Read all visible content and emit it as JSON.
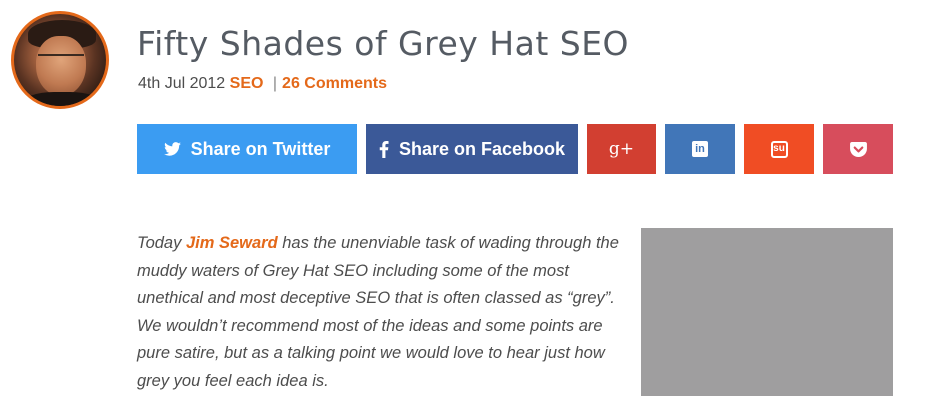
{
  "post": {
    "title": "Fifty Shades of Grey Hat SEO",
    "date": "4th Jul 2012",
    "category": "SEO",
    "separator": "|",
    "comments": "26 Comments"
  },
  "share": {
    "twitter": {
      "label": "Share on Twitter",
      "color": "#3b9cf2",
      "icon": "twitter-bird-icon"
    },
    "facebook": {
      "label": "Share on Facebook",
      "color": "#3b5998",
      "icon": "facebook-f-icon"
    },
    "google_plus": {
      "glyph": "g+",
      "color": "#d23f31",
      "icon": "google-plus-icon"
    },
    "linkedin": {
      "glyph": "in",
      "color": "#4176b8",
      "icon": "linkedin-icon"
    },
    "stumbleupon": {
      "glyph": "su",
      "color": "#f04d24",
      "icon": "stumbleupon-icon"
    },
    "pocket": {
      "color": "#d74d5c",
      "icon": "pocket-icon"
    }
  },
  "article": {
    "intro": "Today ",
    "author": "Jim Seward",
    "body": " has the unenviable task of wading through the muddy waters of Grey Hat SEO including some of the most unethical and most deceptive SEO that is often classed as “grey”. We wouldn’t recommend most of the ideas and some points are pure satire, but as a talking point we would love to hear just how grey you feel each idea is."
  },
  "colors": {
    "accent": "#e4691a",
    "title": "#555b63",
    "text": "#4d4d4d",
    "image_placeholder": "#9f9e9f"
  }
}
